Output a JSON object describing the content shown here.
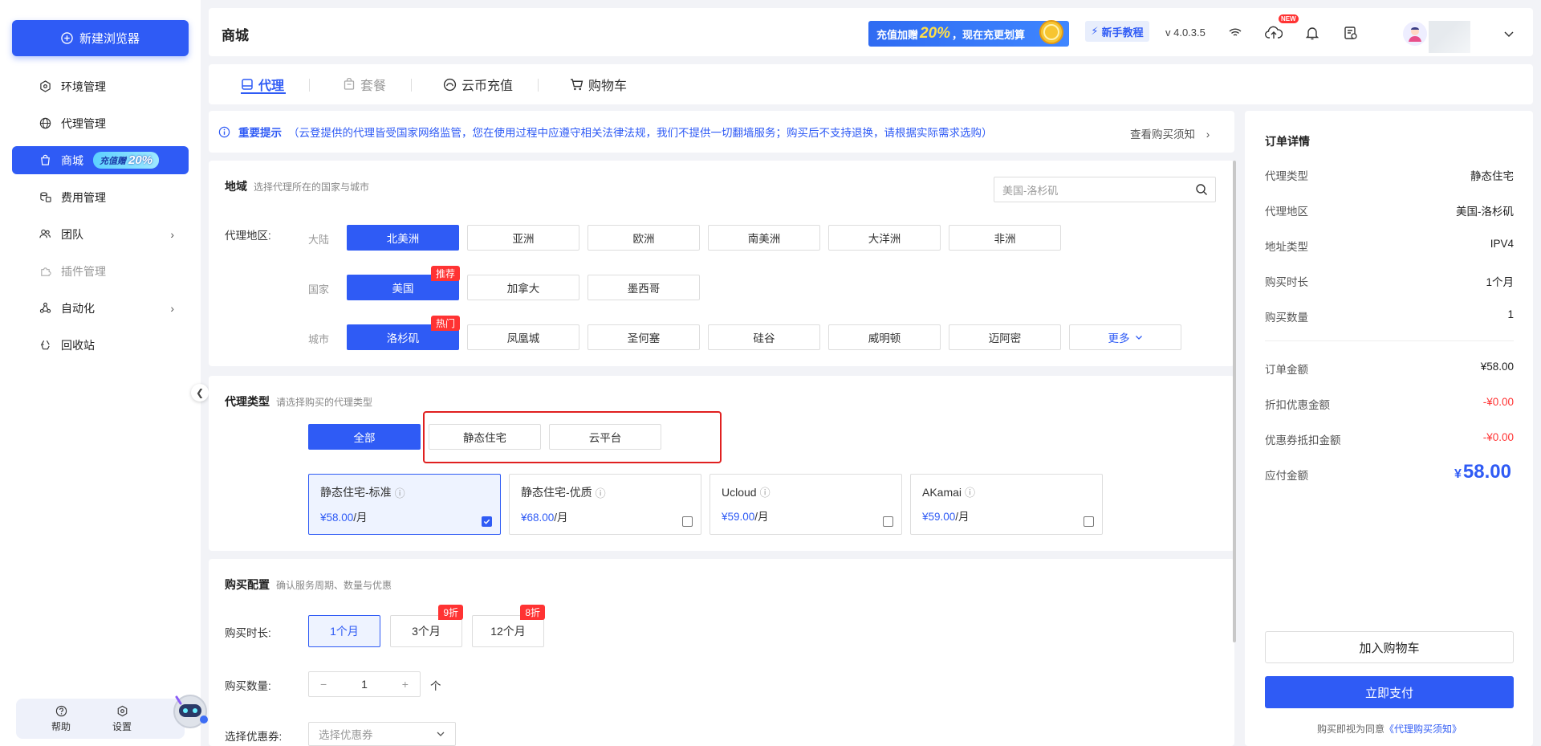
{
  "sidebar": {
    "new_browser": "新建浏览器",
    "items": [
      {
        "label": "环境管理"
      },
      {
        "label": "代理管理"
      },
      {
        "label": "商城",
        "badge_prefix": "充值赠",
        "badge_pct": "20%"
      },
      {
        "label": "费用管理"
      },
      {
        "label": "团队"
      },
      {
        "label": "插件管理"
      },
      {
        "label": "自动化"
      },
      {
        "label": "回收站"
      }
    ],
    "help": "帮助",
    "settings": "设置"
  },
  "header": {
    "title": "商城",
    "banner_prefix": "充值加赠",
    "banner_pct": "20%",
    "banner_suffix": "，现在充更划算",
    "tutorial": "新手教程",
    "version": "v 4.0.3.5",
    "new_badge": "NEW"
  },
  "tabs": [
    {
      "label": "代理"
    },
    {
      "label": "套餐"
    },
    {
      "label": "云币充值"
    },
    {
      "label": "购物车"
    }
  ],
  "notice": {
    "title": "重要提示",
    "text": "（云登提供的代理皆受国家网络监管，您在使用过程中应遵守相关法律法规，我们不提供一切翻墙服务；购买后不支持退换，请根据实际需求选购）",
    "link": "查看购买须知"
  },
  "region": {
    "title": "地域",
    "subtitle": "选择代理所在的国家与城市",
    "search_placeholder": "美国-洛杉矶",
    "area_label": "代理地区:",
    "continent_label": "大陆",
    "continents": [
      "北美洲",
      "亚洲",
      "欧洲",
      "南美洲",
      "大洋洲",
      "非洲"
    ],
    "country_label": "国家",
    "countries": [
      "美国",
      "加拿大",
      "墨西哥"
    ],
    "country_tag": "推荐",
    "city_label": "城市",
    "cities": [
      "洛杉矶",
      "凤凰城",
      "圣何塞",
      "硅谷",
      "威明顿",
      "迈阿密"
    ],
    "city_tag": "热门",
    "more": "更多"
  },
  "proxy_type": {
    "title": "代理类型",
    "subtitle": "请选择购买的代理类型",
    "filters": [
      "全部",
      "静态住宅",
      "云平台"
    ],
    "plans": [
      {
        "name": "静态住宅-标准",
        "price": "¥58.00",
        "unit": "/月",
        "checked": true
      },
      {
        "name": "静态住宅-优质",
        "price": "¥68.00",
        "unit": "/月",
        "checked": false
      },
      {
        "name": "Ucloud",
        "price": "¥59.00",
        "unit": "/月",
        "checked": false
      },
      {
        "name": "AKamai",
        "price": "¥59.00",
        "unit": "/月",
        "checked": false
      }
    ]
  },
  "purchase": {
    "title": "购买配置",
    "subtitle": "确认服务周期、数量与优惠",
    "duration_label": "购买时长:",
    "durations": [
      {
        "label": "1个月",
        "tag": ""
      },
      {
        "label": "3个月",
        "tag": "9折"
      },
      {
        "label": "12个月",
        "tag": "8折"
      }
    ],
    "qty_label": "购买数量:",
    "qty": "1",
    "qty_minus": "−",
    "qty_plus": "+",
    "qty_unit": "个",
    "coupon_label": "选择优惠券:",
    "coupon_placeholder": "选择优惠券"
  },
  "order": {
    "title": "订单详情",
    "rows": [
      {
        "k": "代理类型",
        "v": "静态住宅"
      },
      {
        "k": "代理地区",
        "v": "美国-洛杉矶"
      },
      {
        "k": "地址类型",
        "v": "IPV4"
      },
      {
        "k": "购买时长",
        "v": "1个月"
      },
      {
        "k": "购买数量",
        "v": "1"
      }
    ],
    "amount_label": "订单金额",
    "amount": "¥58.00",
    "discount_label": "折扣优惠金额",
    "discount": "-¥0.00",
    "coupon_label": "优惠券抵扣金额",
    "coupon": "-¥0.00",
    "payable_label": "应付金额",
    "payable_symbol": "¥",
    "payable": "58.00",
    "cart_button": "加入购物车",
    "pay_button": "立即支付",
    "agree_text": "购买即视为同意",
    "agree_link": "《代理购买须知》"
  },
  "colors": {
    "accent": "#2f5bf5",
    "danger": "#f33333",
    "highlight": "#e02020"
  }
}
